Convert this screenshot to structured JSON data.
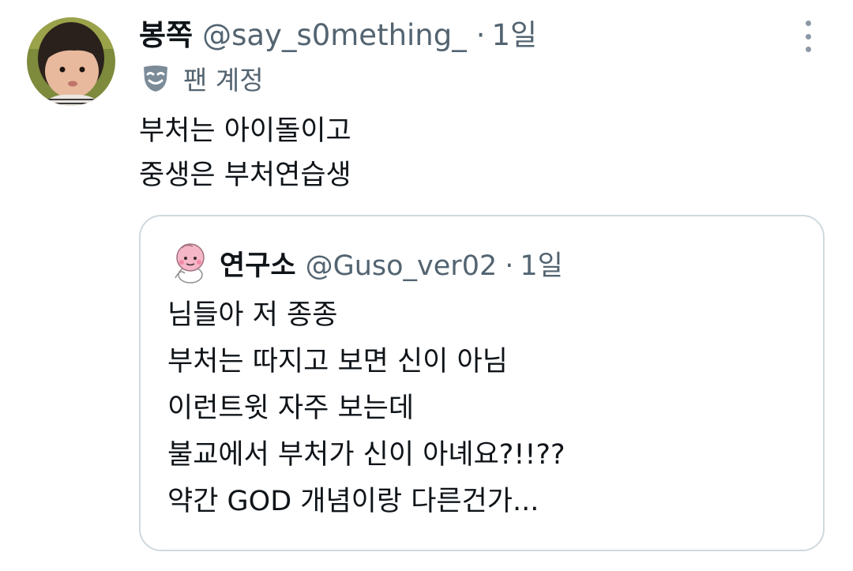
{
  "tweet": {
    "display_name": "봉쪽",
    "handle": "@say_s0mething_",
    "separator": "·",
    "time": "1일",
    "fan_badge_label": "팬 계정",
    "text_lines": [
      "부처는 아이돌이고",
      "중생은 부처연습생"
    ],
    "more_icon": "more-vertical-icon",
    "fan_icon": "theater-mask-icon"
  },
  "quote": {
    "display_name": "연구소",
    "handle": "@Guso_ver02",
    "separator": "·",
    "time": "1일",
    "text_lines": [
      "님들아 저 종종",
      "부처는 따지고 보면 신이 아님",
      "이런트윗 자주 보는데",
      "불교에서 부처가 신이 아녜요?!!??",
      "약간 GOD 개념이랑 다른건가..."
    ]
  },
  "colors": {
    "text_primary": "#0f1419",
    "text_secondary": "#536471",
    "border": "#cfd9de",
    "background": "#ffffff"
  }
}
